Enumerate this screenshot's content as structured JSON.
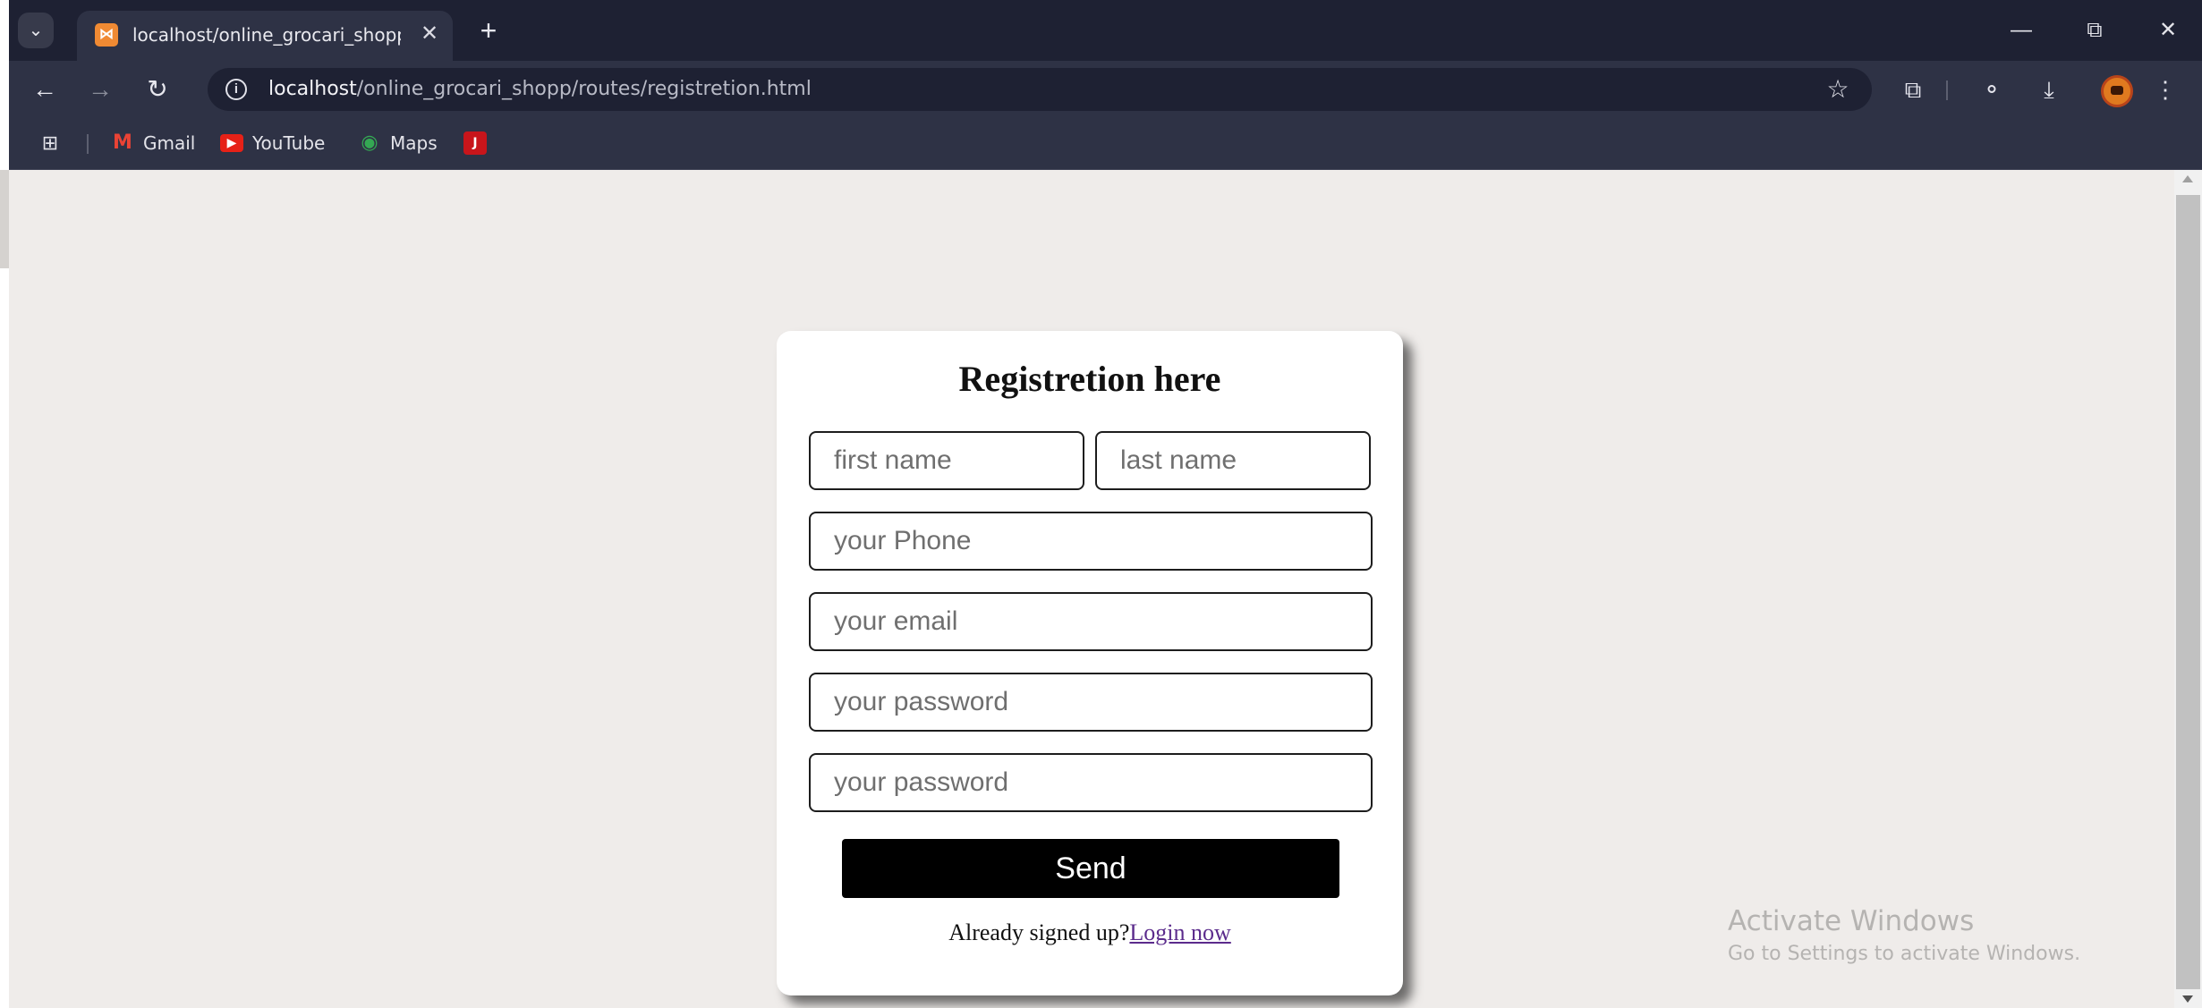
{
  "browser": {
    "tab_title": "localhost/online_grocari_shopp",
    "tab_close": "✕",
    "new_tab": "+",
    "url_host": "localhost",
    "url_path": "/online_grocari_shopp/routes/registretion.html",
    "bookmarks": [
      {
        "label": "Gmail",
        "icon": "gmail-icon"
      },
      {
        "label": "YouTube",
        "icon": "youtube-icon"
      },
      {
        "label": "Maps",
        "icon": "maps-icon"
      },
      {
        "label": "",
        "icon": "j-bookmark-icon",
        "glyph": "J"
      }
    ]
  },
  "form": {
    "title": "Registretion here",
    "first_name_placeholder": "first name",
    "last_name_placeholder": "last name",
    "phone_placeholder": "your Phone",
    "email_placeholder": "your email",
    "password_placeholder": "your password",
    "confirm_password_placeholder": "your password",
    "send_label": "Send",
    "already_text": "Already signed up?",
    "login_link": "Login now"
  },
  "watermark": {
    "title": "Activate Windows",
    "subtitle": "Go to Settings to activate Windows."
  },
  "colors": {
    "page_background": "#efecea",
    "card_background": "#ffffff",
    "button_background": "#000000",
    "chrome_dark": "#1e2133",
    "chrome_toolbar": "#2e3245"
  }
}
